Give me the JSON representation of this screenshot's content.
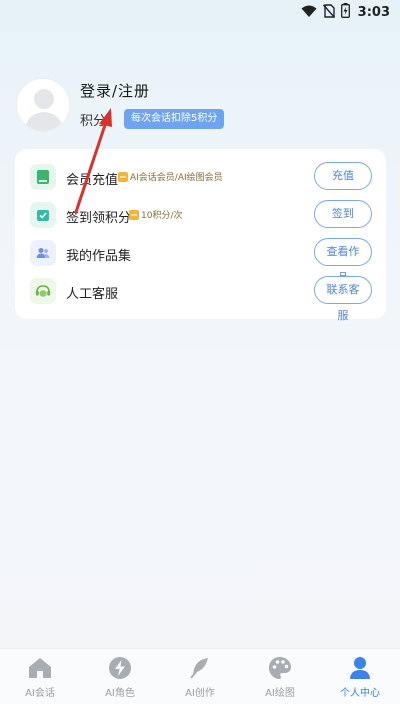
{
  "status_bar": {
    "time": "3:03"
  },
  "profile": {
    "login_text": "登录/注册",
    "points_label": "积分：",
    "deduct_badge": "每次会话扣除5积分"
  },
  "menu": [
    {
      "label": "会员充值",
      "note": "AI会话会员/AI绘图会员",
      "button": "充值",
      "icon": "book-icon",
      "icon_color": "#3cb46e",
      "icon_bg": "#e8f7ee"
    },
    {
      "label": "签到领积分",
      "note": "10积分/次",
      "button": "签到",
      "icon": "checkin-icon",
      "icon_color": "#39b8a6",
      "icon_bg": "#e6f6f4"
    },
    {
      "label": "我的作品集",
      "note": "",
      "button": "查看作品",
      "icon": "people-icon",
      "icon_color": "#6d8ee8",
      "icon_bg": "#eef2fc"
    },
    {
      "label": "人工客服",
      "note": "",
      "button": "联系客服",
      "icon": "service-icon",
      "icon_color": "#6bb34a",
      "icon_bg": "#eef7e9"
    }
  ],
  "bottom_nav": [
    {
      "label": "AI会话",
      "icon": "home-icon",
      "active": false
    },
    {
      "label": "AI角色",
      "icon": "lightning-icon",
      "active": false
    },
    {
      "label": "AI创作",
      "icon": "feather-icon",
      "active": false
    },
    {
      "label": "AI绘图",
      "icon": "palette-icon",
      "active": false
    },
    {
      "label": "个人中心",
      "icon": "person-icon",
      "active": true
    }
  ],
  "colors": {
    "accent": "#3c83e7",
    "badge": "#6ea4ef",
    "annotation_arrow": "#d8322e"
  }
}
